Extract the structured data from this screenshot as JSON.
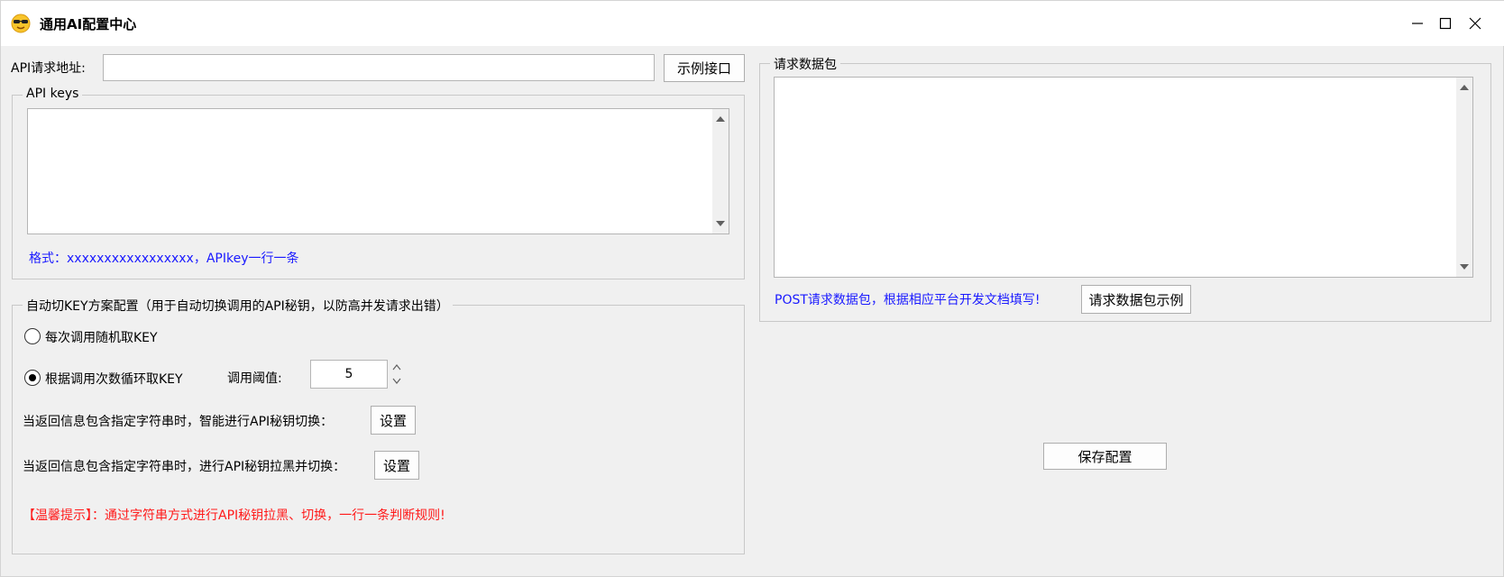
{
  "window": {
    "title": "通用AI配置中心",
    "app_icon": "sunglasses-emoji-icon"
  },
  "left": {
    "api_url": {
      "label": "API请求地址:",
      "value": "",
      "example_button": "示例接口"
    },
    "api_keys": {
      "legend": "API keys",
      "value": "",
      "format_hint": "格式：xxxxxxxxxxxxxxxxx，APIkey一行一条"
    },
    "auto_switch": {
      "legend": "自动切KEY方案配置（用于自动切换调用的API秘钥，以防高并发请求出错）",
      "option_random": "每次调用随机取KEY",
      "option_round_robin": "根据调用次数循环取KEY",
      "selected": "option_round_robin",
      "threshold_label": "调用阈值:",
      "threshold_value": "5",
      "smart_switch_label": "当返回信息包含指定字符串时，智能进行API秘钥切换：",
      "smart_switch_button": "设置",
      "blacklist_label": "当返回信息包含指定字符串时，进行API秘钥拉黑并切换：",
      "blacklist_button": "设置",
      "tip": "【温馨提示】：通过字符串方式进行API秘钥拉黑、切换，一行一条判断规则!"
    }
  },
  "right": {
    "request_body": {
      "legend": "请求数据包",
      "value": "",
      "hint": "POST请求数据包，根据相应平台开发文档填写!",
      "example_button": "请求数据包示例"
    },
    "save_button": "保存配置"
  },
  "colors": {
    "hint_blue": "#1a1aff",
    "hint_red": "#ff1a1a",
    "window_bg": "#f0f0f0"
  }
}
